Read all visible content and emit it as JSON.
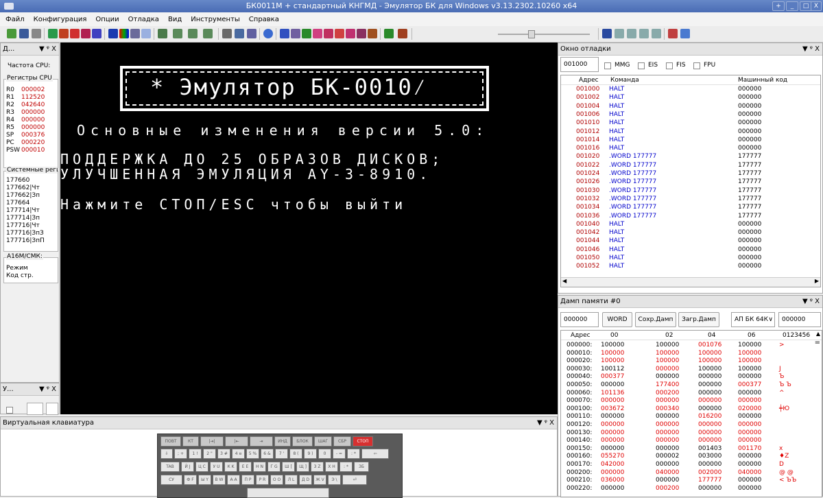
{
  "window": {
    "title": "БК0011М + стандартный КНГМД - Эмулятор БК для Windows v3.13.2302.10260 x64",
    "btn_max": "+",
    "btn_min": "_",
    "btn_restore": "□",
    "btn_close": "X"
  },
  "menu": [
    "Файл",
    "Конфигурация",
    "Опции",
    "Отладка",
    "Вид",
    "Инструменты",
    "Справка"
  ],
  "left_panel": {
    "title": "Д...",
    "controls": "▼ ᵠ X",
    "cpu_freq_label": "Частота CPU:",
    "registers_title": "Регистры CPU",
    "registers": [
      {
        "name": "R0",
        "value": "000002"
      },
      {
        "name": "R1",
        "value": "112520"
      },
      {
        "name": "R2",
        "value": "042640"
      },
      {
        "name": "R3",
        "value": "000000"
      },
      {
        "name": "R4",
        "value": "000000"
      },
      {
        "name": "R5",
        "value": "000000"
      },
      {
        "name": "SP",
        "value": "000376"
      },
      {
        "name": "PC",
        "value": "000220"
      },
      {
        "name": "PSW",
        "value": "000010"
      }
    ],
    "sysregs_title": "Системные регистры",
    "sysregs": [
      "177660",
      "177662|Чт",
      "177662|Зп",
      "177664",
      "177714|Чт",
      "177714|Зп",
      "177716|Чт",
      "177716|ЗпЗ",
      "177716|ЗпП"
    ],
    "a16m_title": "A16M/СМК:",
    "a16m_items": [
      "Режим",
      "Код стр."
    ]
  },
  "left_panel2": {
    "title": "У...",
    "controls": "▼ ᵠ X"
  },
  "screen": {
    "banner": "*  Эмулятор БК-0010⁄",
    "line1": "Основные изменения версии 5.0:",
    "line2": "ПОДДЕРЖКА ДО 25 ОБРАЗОВ ДИСКОВ;",
    "line3": "УЛУЧШЕННАЯ ЭМУЛЯЦИЯ AY-3-8910.",
    "line4": "Нажмите СТОП/ESC чтобы выйти"
  },
  "debug": {
    "title": "Окно отладки",
    "controls": "▼ ᵠ X",
    "address_value": "001000",
    "checks": [
      "MMG",
      "EIS",
      "FIS",
      "FPU"
    ],
    "headers": [
      "Адрес",
      "Команда",
      "Машинный код"
    ],
    "rows": [
      {
        "a": "001000",
        "c": "HALT",
        "m": "000000"
      },
      {
        "a": "001002",
        "c": "HALT",
        "m": "000000"
      },
      {
        "a": "001004",
        "c": "HALT",
        "m": "000000"
      },
      {
        "a": "001006",
        "c": "HALT",
        "m": "000000"
      },
      {
        "a": "001010",
        "c": "HALT",
        "m": "000000"
      },
      {
        "a": "001012",
        "c": "HALT",
        "m": "000000"
      },
      {
        "a": "001014",
        "c": "HALT",
        "m": "000000"
      },
      {
        "a": "001016",
        "c": "HALT",
        "m": "000000"
      },
      {
        "a": "001020",
        "c": ".WORD 177777",
        "m": "177777"
      },
      {
        "a": "001022",
        "c": ".WORD 177777",
        "m": "177777"
      },
      {
        "a": "001024",
        "c": ".WORD 177777",
        "m": "177777"
      },
      {
        "a": "001026",
        "c": ".WORD 177777",
        "m": "177777"
      },
      {
        "a": "001030",
        "c": ".WORD 177777",
        "m": "177777"
      },
      {
        "a": "001032",
        "c": ".WORD 177777",
        "m": "177777"
      },
      {
        "a": "001034",
        "c": ".WORD 177777",
        "m": "177777"
      },
      {
        "a": "001036",
        "c": ".WORD 177777",
        "m": "177777"
      },
      {
        "a": "001040",
        "c": "HALT",
        "m": "000000"
      },
      {
        "a": "001042",
        "c": "HALT",
        "m": "000000"
      },
      {
        "a": "001044",
        "c": "HALT",
        "m": "000000"
      },
      {
        "a": "001046",
        "c": "HALT",
        "m": "000000"
      },
      {
        "a": "001050",
        "c": "HALT",
        "m": "000000"
      },
      {
        "a": "001052",
        "c": "HALT",
        "m": "000000"
      }
    ],
    "scroll_left": "◀",
    "scroll_right": "▶"
  },
  "dump": {
    "title": "Дамп памяти #0",
    "controls": "▼ ᵠ X",
    "address_value": "000000",
    "word_btn": "WORD",
    "save_btn": "Сохр.Дамп",
    "load_btn": "Загр.Дамп",
    "mode_select": "АП БК 64К",
    "mode_arrow": "∨",
    "addr2_value": "000000",
    "headers": [
      "Адрес",
      "00",
      "02",
      "04",
      "06",
      "0123456"
    ],
    "scroll_up": "▲",
    "scroll_thumb": "=",
    "rows": [
      {
        "a": "000000:",
        "v": [
          "100000",
          "100000",
          "001076",
          "100000"
        ],
        "r": [
          false,
          false,
          true,
          false
        ],
        "t": ">"
      },
      {
        "a": "000010:",
        "v": [
          "100000",
          "100000",
          "100000",
          "100000"
        ],
        "r": [
          true,
          true,
          true,
          true
        ],
        "t": ""
      },
      {
        "a": "000020:",
        "v": [
          "100000",
          "100000",
          "100000",
          "100000"
        ],
        "r": [
          true,
          true,
          true,
          true
        ],
        "t": ""
      },
      {
        "a": "000030:",
        "v": [
          "100112",
          "000000",
          "100000",
          "100000"
        ],
        "r": [
          false,
          true,
          false,
          false
        ],
        "t": "J"
      },
      {
        "a": "000040:",
        "v": [
          "000377",
          "000000",
          "000000",
          "000000"
        ],
        "r": [
          true,
          false,
          false,
          false
        ],
        "t": "Ъ"
      },
      {
        "a": "000050:",
        "v": [
          "000000",
          "177400",
          "000000",
          "000377"
        ],
        "r": [
          false,
          true,
          false,
          true
        ],
        "t": "Ъ Ъ"
      },
      {
        "a": "000060:",
        "v": [
          "101136",
          "000200",
          "000000",
          "000000"
        ],
        "r": [
          true,
          true,
          false,
          false
        ],
        "t": "^"
      },
      {
        "a": "000070:",
        "v": [
          "000000",
          "000000",
          "000000",
          "000000"
        ],
        "r": [
          true,
          true,
          true,
          true
        ],
        "t": ""
      },
      {
        "a": "000100:",
        "v": [
          "003672",
          "000340",
          "000000",
          "020000"
        ],
        "r": [
          true,
          true,
          false,
          true
        ],
        "t": "╪Ю"
      },
      {
        "a": "000110:",
        "v": [
          "000000",
          "000000",
          "016200",
          "000000"
        ],
        "r": [
          false,
          false,
          true,
          false
        ],
        "t": ""
      },
      {
        "a": "000120:",
        "v": [
          "000000",
          "000000",
          "000000",
          "000000"
        ],
        "r": [
          true,
          true,
          true,
          true
        ],
        "t": ""
      },
      {
        "a": "000130:",
        "v": [
          "000000",
          "000000",
          "000000",
          "000000"
        ],
        "r": [
          true,
          true,
          true,
          true
        ],
        "t": ""
      },
      {
        "a": "000140:",
        "v": [
          "000000",
          "000000",
          "000000",
          "000000"
        ],
        "r": [
          true,
          true,
          true,
          true
        ],
        "t": ""
      },
      {
        "a": "000150:",
        "v": [
          "000000",
          "000000",
          "001403",
          "001170"
        ],
        "r": [
          false,
          false,
          false,
          true
        ],
        "t": "x"
      },
      {
        "a": "000160:",
        "v": [
          "055270",
          "000002",
          "003000",
          "000000"
        ],
        "r": [
          true,
          false,
          false,
          false
        ],
        "t": "♦Z"
      },
      {
        "a": "000170:",
        "v": [
          "042000",
          "000000",
          "000000",
          "000000"
        ],
        "r": [
          true,
          false,
          false,
          false
        ],
        "t": "D"
      },
      {
        "a": "000200:",
        "v": [
          "000000",
          "040000",
          "002000",
          "040000"
        ],
        "r": [
          true,
          true,
          true,
          true
        ],
        "t": "@ @"
      },
      {
        "a": "000210:",
        "v": [
          "036000",
          "000000",
          "177777",
          "000000"
        ],
        "r": [
          true,
          false,
          true,
          false
        ],
        "t": "< ЪЪ"
      },
      {
        "a": "000220:",
        "v": [
          "000000",
          "000200",
          "000000",
          "000000"
        ],
        "r": [
          false,
          true,
          false,
          false
        ],
        "t": ""
      }
    ]
  },
  "vkbd": {
    "title": "Виртуальная клавиатура",
    "controls": "▼ ᵠ X",
    "row1": [
      "ПОВТ",
      "КТ",
      "|⇥|",
      "|⇤",
      "⇥",
      "ИНД СУ",
      "БЛОК РЕД",
      "ШАГ",
      "СБР",
      "СТОП"
    ],
    "row2": [
      "⇩",
      "; +",
      "1 !",
      "2 \"",
      "3 #",
      "4 ¤",
      "5 %",
      "6 &",
      "7 '",
      "8 (",
      "9 )",
      "0",
      "- =",
      ": *",
      "⇦"
    ],
    "row3": [
      "TAB",
      "Й J",
      "Ц C",
      "У U",
      "К K",
      "Е E",
      "Н N",
      "Г G",
      "Ш [",
      "Щ ]",
      "З Z",
      "Х H",
      ": *",
      "ЗБ"
    ],
    "row4": [
      "СУ",
      "Ф F",
      "Ы Y",
      "В W",
      "А A",
      "П P",
      "Р R",
      "О O",
      "Л L",
      "Д D",
      "Ж V",
      "Э \\",
      "⏎"
    ]
  }
}
